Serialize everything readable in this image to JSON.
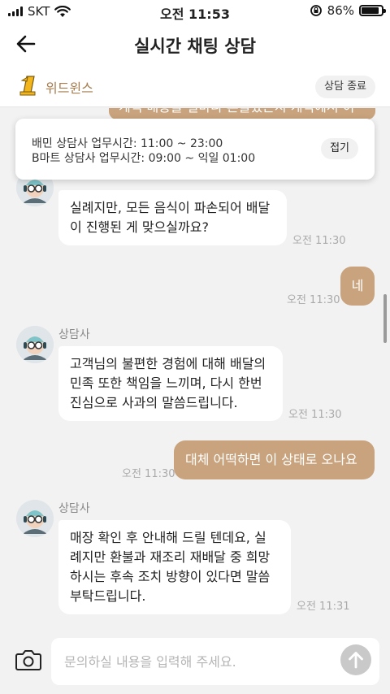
{
  "status_bar": {
    "carrier": "SKT",
    "time": "오전 11:53",
    "battery": "86%",
    "battery_fraction": 0.86
  },
  "header": {
    "title": "실시간 채팅 상담"
  },
  "store": {
    "name": "위드윈스",
    "end_button": "상담 종료"
  },
  "notice": {
    "line1": "배민 상담사 업무시간: 11:00 ~ 23:00",
    "line2": "B마트 상담사 업무시간: 09:00 ~ 익일 01:00",
    "fold_button": "접기"
  },
  "chat": {
    "peek_text": "케익 배송을 얼마나 흔들었는지 케익에서 이",
    "agent_name": "상담사",
    "messages": [
      {
        "from": "agent",
        "text_lines": [
          "실례지만, 모든 음식이 파손되어 배달",
          "이 진행된 게 맞으실까요?"
        ],
        "time": "오전 11:30"
      },
      {
        "from": "user",
        "text": "네",
        "time": "오전 11:30"
      },
      {
        "from": "agent",
        "text_lines": [
          "고객님의 불편한 경험에 대해 배달의",
          "민족 또한 책임을 느끼며, 다시 한번",
          "진심으로 사과의 말씀드립니다."
        ],
        "time": "오전 11:30"
      },
      {
        "from": "user",
        "text": "대체 어떡하면 이 상태로 오나요",
        "time": "오전 11:30"
      },
      {
        "from": "agent",
        "text_lines": [
          "매장 확인 후 안내해 드릴 텐데요, 실",
          "례지만 환불과 재조리 재배달 중 희망",
          "하시는 후속 조치 방향이 있다면 말씀",
          "부탁드립니다."
        ],
        "time": "오전 11:31"
      }
    ]
  },
  "input": {
    "placeholder": "문의하실 내용을 입력해 주세요."
  },
  "colors": {
    "accent": "#c8a37d",
    "brand_text": "#a67c4e",
    "logo_yellow": "#f2b51c",
    "background": "#f2f2f2"
  }
}
